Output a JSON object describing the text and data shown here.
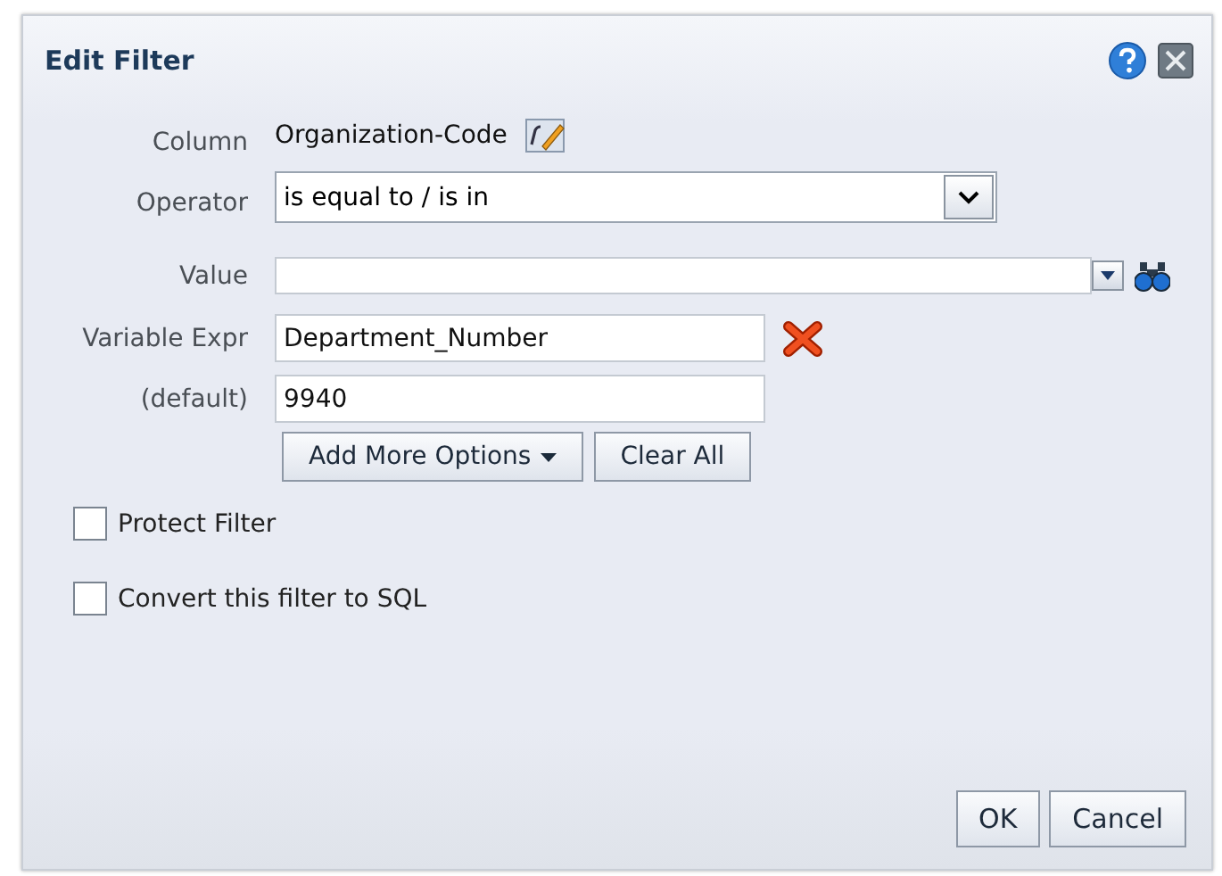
{
  "dialog": {
    "title": "Edit Filter"
  },
  "column": {
    "label": "Column",
    "value": "Organization-Code"
  },
  "fields": [
    {
      "kind": "select",
      "label": "Operator",
      "value": "is equal to / is in"
    },
    {
      "kind": "combo",
      "label": "Value"
    },
    {
      "kind": "variable",
      "label": "Variable Expr",
      "value": "Department_Number"
    },
    {
      "kind": "text",
      "label": "(default)",
      "value": "9940"
    }
  ],
  "option_buttons": [
    {
      "label": "Add More Options",
      "has_menu": true
    },
    {
      "label": "Clear All",
      "has_menu": false
    }
  ],
  "checkboxes": [
    {
      "label": "Protect Filter",
      "checked": false
    },
    {
      "label": "Convert this filter to SQL",
      "checked": false
    }
  ],
  "buttons": [
    "OK",
    "Cancel"
  ]
}
